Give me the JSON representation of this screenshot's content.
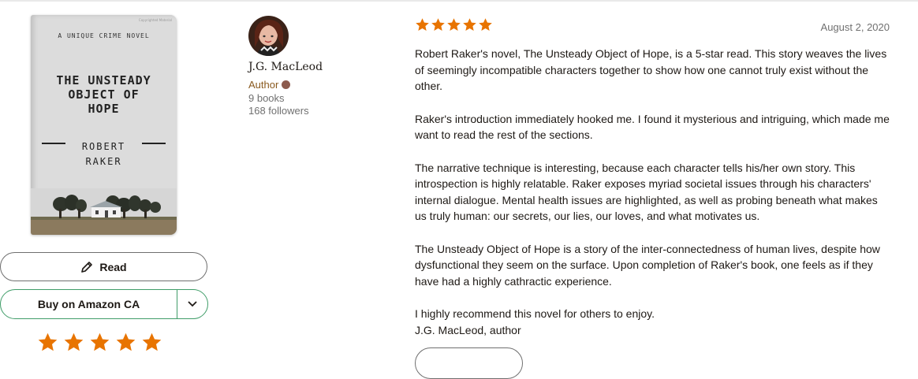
{
  "book": {
    "cover_series": "A UNIQUE CRIME NOVEL",
    "cover_mark": "Copyrighted Material",
    "cover_title_lines": [
      "THE UNSTEADY",
      "OBJECT OF",
      "HOPE"
    ],
    "cover_author_lines": [
      "ROBERT",
      "RAKER"
    ]
  },
  "actions": {
    "read_label": "Read",
    "buy_label": "Buy on Amazon CA"
  },
  "user_rating": {
    "value": 5,
    "max": 5
  },
  "reviewer": {
    "name": "J.G. MacLeod",
    "role": "Author",
    "books": "9 books",
    "followers": "168 followers"
  },
  "review": {
    "rating": 5,
    "date": "August 2, 2020",
    "paragraphs": [
      "Robert Raker's novel, The Unsteady Object of Hope, is a 5-star read. This story weaves the lives of seemingly incompatible characters together to show how one cannot truly exist without the other.",
      "Raker's introduction immediately hooked me. I found it mysterious and intriguing, which made me want to read the rest of the sections.",
      "The narrative technique is interesting, because each character tells his/her own story. This introspection is highly relatable. Raker exposes myriad societal issues through his characters' internal dialogue. Mental health issues are highlighted, as well as probing beneath what makes us truly human: our secrets, our lies, our loves, and what motivates us.",
      "The Unsteady Object of Hope is a story of the inter-connectedness of human lives, despite how dysfunctional they seem on the surface. Upon completion of Raker's book, one feels as if they have had a highly cathractic experience."
    ],
    "closing_line_1": "I highly recommend this novel for others to enjoy.",
    "closing_line_2": "J.G. MacLeod, author"
  },
  "colors": {
    "star": "#e87400",
    "green": "#409d69"
  }
}
